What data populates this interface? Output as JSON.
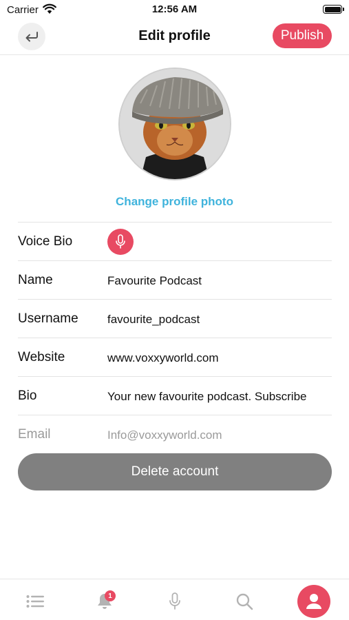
{
  "status_bar": {
    "carrier": "Carrier",
    "time": "12:56 AM"
  },
  "header": {
    "title": "Edit profile",
    "publish_label": "Publish"
  },
  "avatar": {
    "change_photo_label": "Change profile photo"
  },
  "form": {
    "voice_bio_label": "Voice Bio",
    "name": {
      "label": "Name",
      "value": "Favourite Podcast"
    },
    "username": {
      "label": "Username",
      "value": "favourite_podcast"
    },
    "website": {
      "label": "Website",
      "value": "www.voxxyworld.com"
    },
    "bio": {
      "label": "Bio",
      "value": "Your new favourite podcast. Subscribe"
    },
    "email": {
      "label": "Email",
      "value": "Info@voxxyworld.com"
    }
  },
  "delete_label": "Delete account",
  "tab_bar": {
    "notification_count": "1",
    "items": [
      "list-icon",
      "bell-icon",
      "microphone-icon",
      "search-icon",
      "profile-icon"
    ],
    "active": "profile-icon"
  },
  "colors": {
    "accent": "#e84a62",
    "link": "#3fb3dc",
    "delete_button": "#808080"
  }
}
